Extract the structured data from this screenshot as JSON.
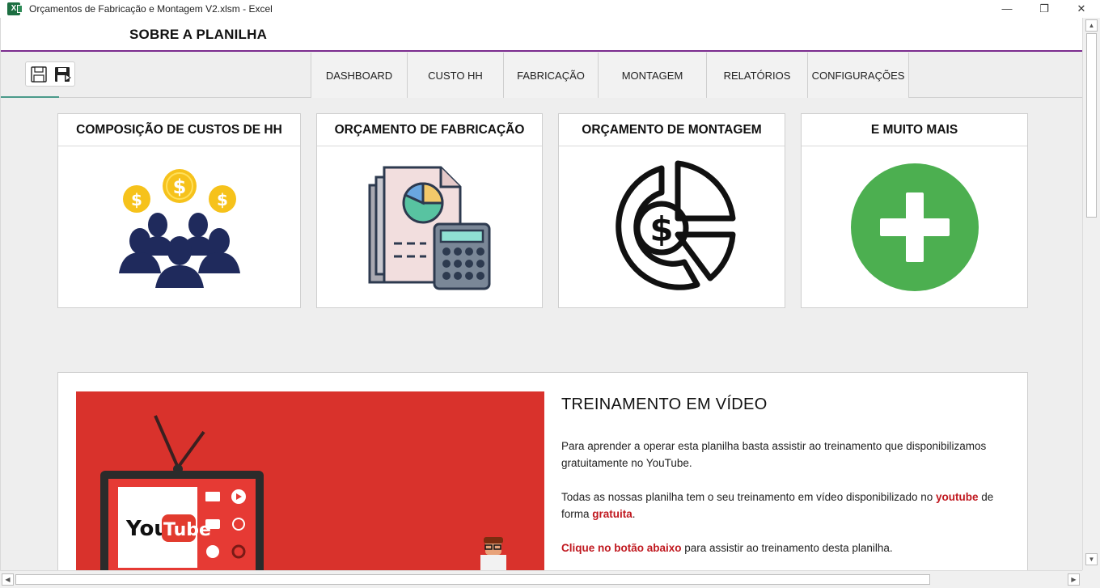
{
  "window": {
    "title": "Orçamentos de Fabricação e Montagem V2.xlsm - Excel",
    "app_icon_letter": "X",
    "controls": {
      "minimize": "—",
      "restore": "❐",
      "close": "✕"
    }
  },
  "header": {
    "title": "SOBRE A PLANILHA"
  },
  "toolbar": {
    "save_icon": "save-icon",
    "save_as_icon": "save-as-icon"
  },
  "nav": {
    "tabs": [
      {
        "label": "DASHBOARD"
      },
      {
        "label": "CUSTO HH"
      },
      {
        "label": "FABRICAÇÃO"
      },
      {
        "label": "MONTAGEM"
      },
      {
        "label": "RELATÓRIOS"
      },
      {
        "label": "CONFIGURAÇÕES"
      }
    ]
  },
  "cards": [
    {
      "title": "COMPOSIÇÃO DE CUSTOS DE HH",
      "icon": "people-dollar-icon"
    },
    {
      "title": "ORÇAMENTO DE FABRICAÇÃO",
      "icon": "document-calculator-icon"
    },
    {
      "title": "ORÇAMENTO DE MONTAGEM",
      "icon": "dollar-pie-chart-icon"
    },
    {
      "title": "E MUITO MAIS",
      "icon": "plus-circle-icon"
    }
  ],
  "video": {
    "heading": "TREINAMENTO EM VÍDEO",
    "p1": "Para aprender a operar esta planilha  basta assistir ao treinamento que disponibilizamos gratuitamente no YouTube.",
    "p2_a": "Todas as nossas planilha tem o seu treinamento em vídeo disponibilizado no ",
    "p2_b": "youtube",
    "p2_c": " de forma ",
    "p2_d": "gratuita",
    "p2_e": ".",
    "p3_a": "Clique no botão abaixo",
    "p3_b": " para assistir ao treinamento desta planilha.",
    "logo_text_a": "You",
    "logo_text_b": "Tube"
  },
  "scrollbars": {
    "up": "▲",
    "down": "▼",
    "left": "◀",
    "right": "▶"
  },
  "colors": {
    "accent_purple": "#7b2c8e",
    "dollar_yellow": "#f6c21b",
    "people_navy": "#1f2a5c",
    "plus_green": "#4caf50",
    "youtube_red": "#d9322c",
    "link_red": "#c0181f"
  }
}
